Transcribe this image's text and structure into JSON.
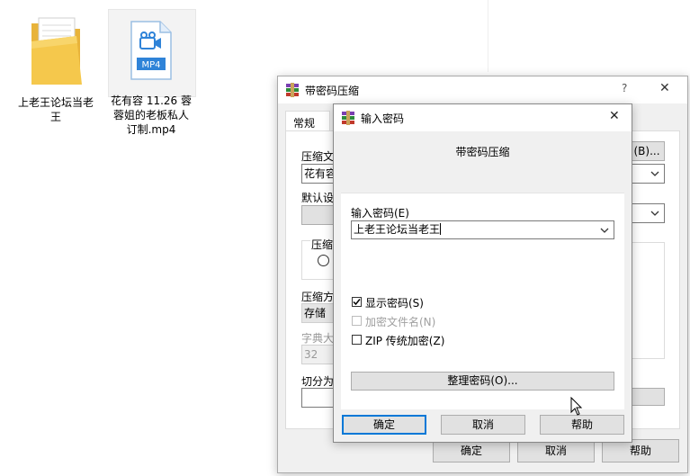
{
  "desktop": {
    "folder": {
      "label": "上老王论坛当老王"
    },
    "video": {
      "badge": "MP4",
      "label": "花有容 11.26 蓉蓉姐的老板私人订制.mp4"
    }
  },
  "bg_window": {
    "title": "带密码压缩",
    "help_glyph": "?",
    "close_glyph": "✕",
    "tab_general": "常规",
    "archive_name_label": "压缩文",
    "archive_name_value": "花有容",
    "browse_button": "(B)...",
    "default_settings_label": "默认设",
    "format_label": "压缩",
    "compression_method_label": "压缩方",
    "compression_method_value": "存储",
    "dictionary_label": "字典大",
    "dictionary_value": "32",
    "split_label": "切分为",
    "ok_button": "确定",
    "cancel_button": "取消",
    "help_button": "帮助"
  },
  "dialog": {
    "title": "输入密码",
    "close_glyph": "✕",
    "heading": "带密码压缩",
    "password_label": "输入密码(E)",
    "password_value": "上老王论坛当老王",
    "show_password": {
      "label": "显示密码(S)",
      "checked": true
    },
    "encrypt_filenames": {
      "label": "加密文件名(N)",
      "checked": false,
      "disabled": true
    },
    "zip_legacy": {
      "label": "ZIP 传统加密(Z)",
      "checked": false
    },
    "organize_button": "整理密码(O)...",
    "ok_button": "确定",
    "cancel_button": "取消",
    "help_button": "帮助"
  },
  "colors": {
    "accent": "#0078d7",
    "folder": "#f5c84c",
    "mp4_badge": "#2f83d8"
  }
}
